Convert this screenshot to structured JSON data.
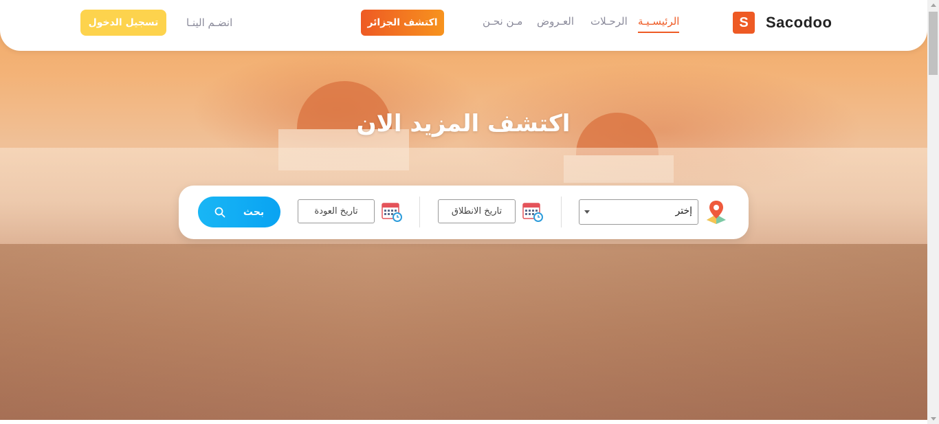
{
  "brand": {
    "logo_letter": "S",
    "name": "Sacodoo"
  },
  "nav": {
    "items": [
      {
        "label": "الرئيسـيـة",
        "active": true
      },
      {
        "label": "الرحـلات",
        "active": false
      },
      {
        "label": "العـروض",
        "active": false
      },
      {
        "label": "مـن نحـن",
        "active": false
      }
    ],
    "explore_button": "اكتشف الجزائر",
    "join_link": "انضـم الينـا",
    "login_button": "تسجيل الدخول"
  },
  "hero": {
    "title": "اكتشف المزيد الان"
  },
  "search": {
    "select_value": "إختر",
    "departure_date": "تاريخ الانطلاق",
    "return_date": "تاريخ العودة",
    "search_button": "بحث"
  },
  "colors": {
    "accent": "#ee5a24",
    "accent_gradient_end": "#f7931e",
    "login": "#fdd34d",
    "search": "#19b6f5"
  },
  "icons": {
    "logo": "brand-logo-icon",
    "location": "map-pin-icon",
    "calendar": "calendar-icon",
    "search": "search-icon"
  }
}
